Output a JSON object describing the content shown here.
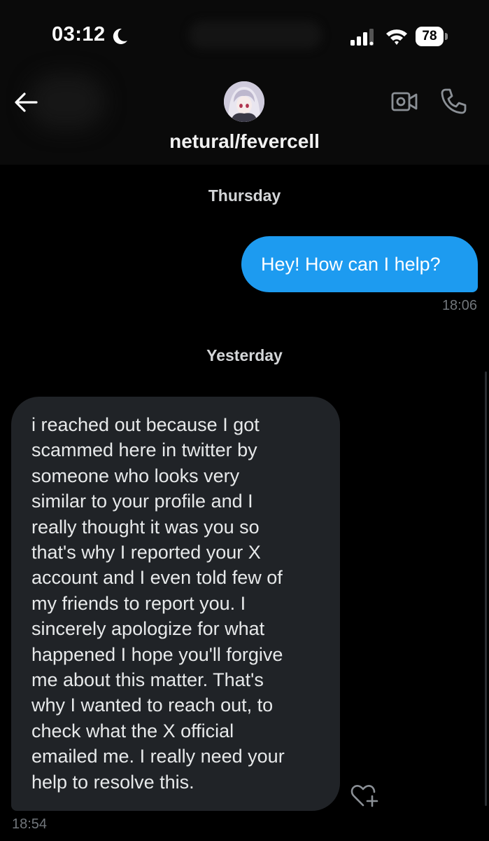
{
  "status_bar": {
    "time": "03:12",
    "battery": "78",
    "icons": [
      "moon-icon",
      "signal-icon",
      "wifi-icon",
      "battery-icon"
    ]
  },
  "header": {
    "contact_name": "netural/fevercell",
    "icons": [
      "back-arrow-icon",
      "video-camera-icon",
      "phone-icon"
    ]
  },
  "conversation": {
    "day_1": "Thursday",
    "sent_message": {
      "text": "Hey! How can I help?",
      "time": "18:06"
    },
    "day_2": "Yesterday",
    "received_message": {
      "lines": [
        "i  reached out because I got",
        "scammed here in twitter by",
        "someone who looks very",
        "similar to your profile and I",
        "really thought it was you so",
        "that's why I reported your X",
        "account and I even told few of",
        "my friends to report you. I",
        "sincerely apologize for what",
        "happened I hope you'll forgive",
        "me about this matter. That's",
        "why I wanted to reach out, to",
        "check what the X official",
        "emailed me. I really need your",
        "help to resolve this."
      ],
      "time": "18:54"
    }
  },
  "colors": {
    "background": "#000000",
    "sent_bubble": "#1d9bf0",
    "received_bubble": "#202327",
    "timestamp": "#71767b"
  }
}
